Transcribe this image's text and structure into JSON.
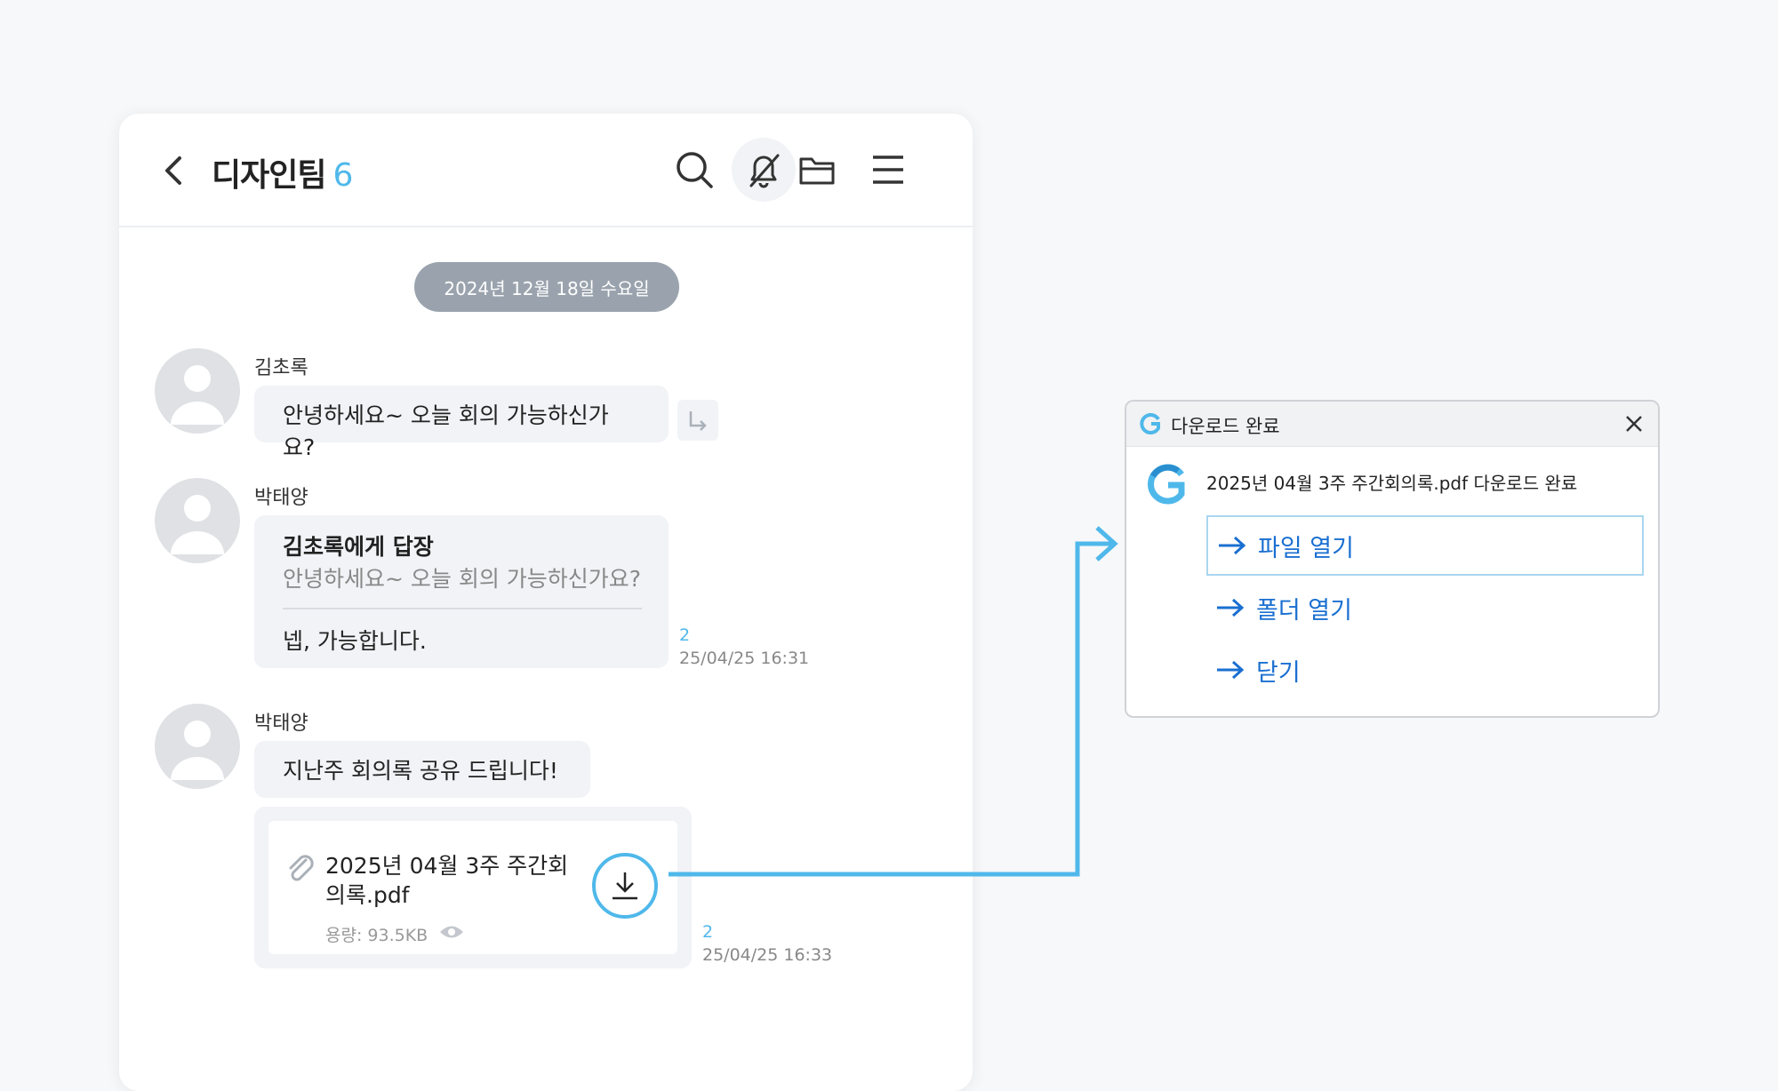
{
  "header": {
    "title": "디자인팀",
    "member_count": "6"
  },
  "chat": {
    "date_divider": "2024년 12월 18일 수요일",
    "messages": [
      {
        "sender": "김초록",
        "text": "안녕하세요~ 오늘 회의 가능하신가요?"
      },
      {
        "sender": "박태양",
        "reply_to_label": "김초록에게 답장",
        "quoted_text": "안녕하세요~ 오늘 회의 가능하신가요?",
        "text": "넵, 가능합니다.",
        "unread_count": "2",
        "timestamp": "25/04/25 16:31"
      },
      {
        "sender": "박태양",
        "text": "지난주 회의록 공유 드립니다!",
        "file": {
          "name": "2025년 04월 3주 주간회의록.pdf",
          "size": "용량: 93.5KB"
        },
        "unread_count": "2",
        "timestamp": "25/04/25 16:33"
      }
    ]
  },
  "dialog": {
    "title": "다운로드 완료",
    "message": "2025년 04월 3주 주간회의록.pdf 다운로드 완료",
    "actions": [
      "파일 열기",
      "폴더 열기",
      "닫기"
    ]
  },
  "colors": {
    "accent": "#4fb8ea",
    "link": "#1a6fd1",
    "date_pill": "#9aa3ad",
    "bubble": "#f1f3f7"
  }
}
